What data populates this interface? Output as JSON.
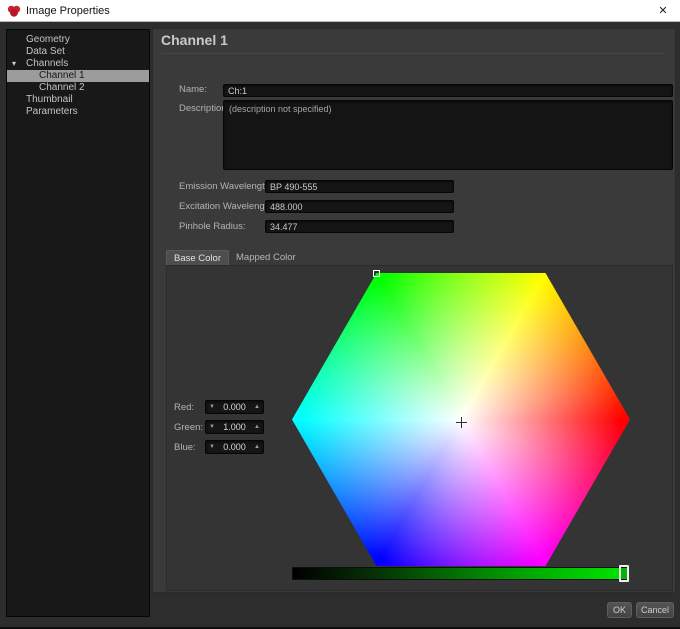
{
  "window": {
    "title": "Image Properties"
  },
  "icons": {
    "close": "✕",
    "tree_expanded": "▾",
    "spinner_down": "▼",
    "spinner_up": "▲"
  },
  "sidebar": {
    "items": [
      {
        "label": "Geometry"
      },
      {
        "label": "Data Set"
      },
      {
        "label": "Channels",
        "expanded": true
      },
      {
        "label": "Channel 1",
        "selected": true
      },
      {
        "label": "Channel 2"
      },
      {
        "label": "Thumbnail"
      },
      {
        "label": "Parameters"
      }
    ]
  },
  "main": {
    "title": "Channel 1",
    "fields": {
      "name_label": "Name:",
      "name_value": "Ch:1",
      "description_label": "Description:",
      "description_value": "(description not specified)",
      "emission_label": "Emission Wavelength:",
      "emission_value": "BP 490-555",
      "excitation_label": "Excitation Wavelength:",
      "excitation_value": "488.000",
      "pinhole_label": "Pinhole Radius:",
      "pinhole_value": "34.477"
    },
    "tabs": [
      {
        "label": "Base Color",
        "active": true
      },
      {
        "label": "Mapped Color",
        "active": false
      }
    ],
    "color_picker": {
      "red_label": "Red:",
      "red_value": "0.000",
      "green_label": "Green:",
      "green_value": "1.000",
      "blue_label": "Blue:",
      "blue_value": "0.000",
      "selected_color": "#00ff00",
      "ramp_start_color": "#000000",
      "ramp_end_color": "#00e800"
    }
  },
  "footer": {
    "ok_label": "OK",
    "cancel_label": "Cancel"
  },
  "colors": {
    "app_icon_red": "#cf1f2f",
    "panel_bg": "#3a3a3a",
    "sidebar_bg": "#181818",
    "selection_bg": "#9c9c9c"
  }
}
